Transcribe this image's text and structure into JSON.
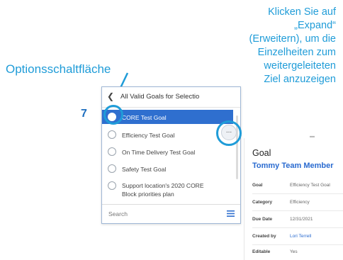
{
  "annotations": {
    "left_label": "Optionsschaltfläche",
    "step_number": "7",
    "right_lines": [
      "Klicken Sie auf",
      "„Expand“",
      "(Erweitern), um die",
      "Einzelheiten zum",
      "weitergeleiteten",
      "Ziel anzuzeigen"
    ]
  },
  "panel": {
    "title": "All Valid Goals for Selectio",
    "options": [
      {
        "label": "CORE Test Goal",
        "selected": true
      },
      {
        "label": "Efficiency Test Goal",
        "selected": false
      },
      {
        "label": "On Time Delivery Test Goal",
        "selected": false
      },
      {
        "label": "Safety Test Goal",
        "selected": false
      },
      {
        "label": "Support location's 2020 CORE",
        "label2": "Block priorities plan",
        "selected": false
      }
    ],
    "search_placeholder": "Search"
  },
  "more_button": {
    "label": "..."
  },
  "detail": {
    "heading": "Goal",
    "subheading": "Tommy Team Member",
    "rows": [
      {
        "key": "Goal",
        "value": "Efficiency Test Goal"
      },
      {
        "key": "Category",
        "value": "Efficiency"
      },
      {
        "key": "Due Date",
        "value": "12/31/2021"
      },
      {
        "key": "Created by",
        "value": "Lori Terrell"
      },
      {
        "key": "Editable",
        "value": "Yes"
      }
    ]
  },
  "colors": {
    "accent": "#1f9cd8",
    "selected_bg": "#2f6fcf",
    "link": "#2a6bd0"
  }
}
